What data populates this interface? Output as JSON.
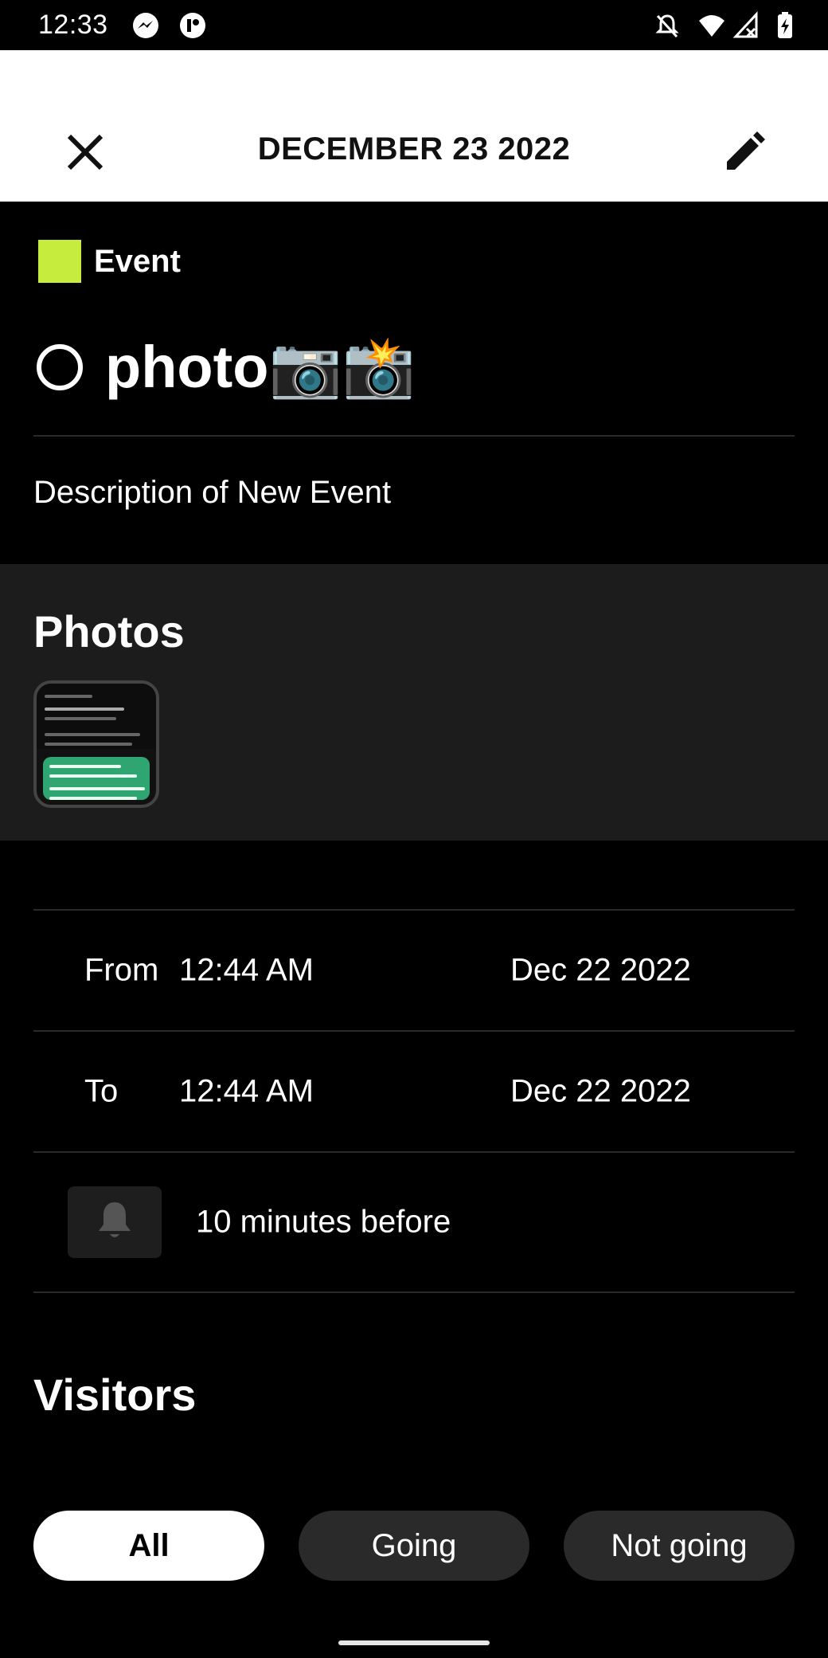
{
  "status_bar": {
    "time": "12:33",
    "icons": [
      "messenger-icon",
      "app-icon",
      "notifications-off-icon",
      "wifi-icon",
      "signal-icon",
      "battery-charging-icon"
    ]
  },
  "header": {
    "title": "DECEMBER 23 2022",
    "close_icon": "close-icon",
    "edit_icon": "edit-pencil-icon"
  },
  "event": {
    "type_label": "Event",
    "type_color": "#c6ec3d",
    "title": "photo📷📸",
    "description": "Description of New Event"
  },
  "photos": {
    "title": "Photos"
  },
  "schedule": {
    "from": {
      "label": "From",
      "time": "12:44 AM",
      "date": "Dec 22 2022"
    },
    "to": {
      "label": "To",
      "time": "12:44 AM",
      "date": "Dec 22 2022"
    }
  },
  "reminder": {
    "icon": "bell-icon",
    "text": "10 minutes before"
  },
  "visitors": {
    "title": "Visitors",
    "filters": [
      {
        "label": "All",
        "active": true
      },
      {
        "label": "Going",
        "active": false
      },
      {
        "label": "Not going",
        "active": false
      }
    ]
  }
}
